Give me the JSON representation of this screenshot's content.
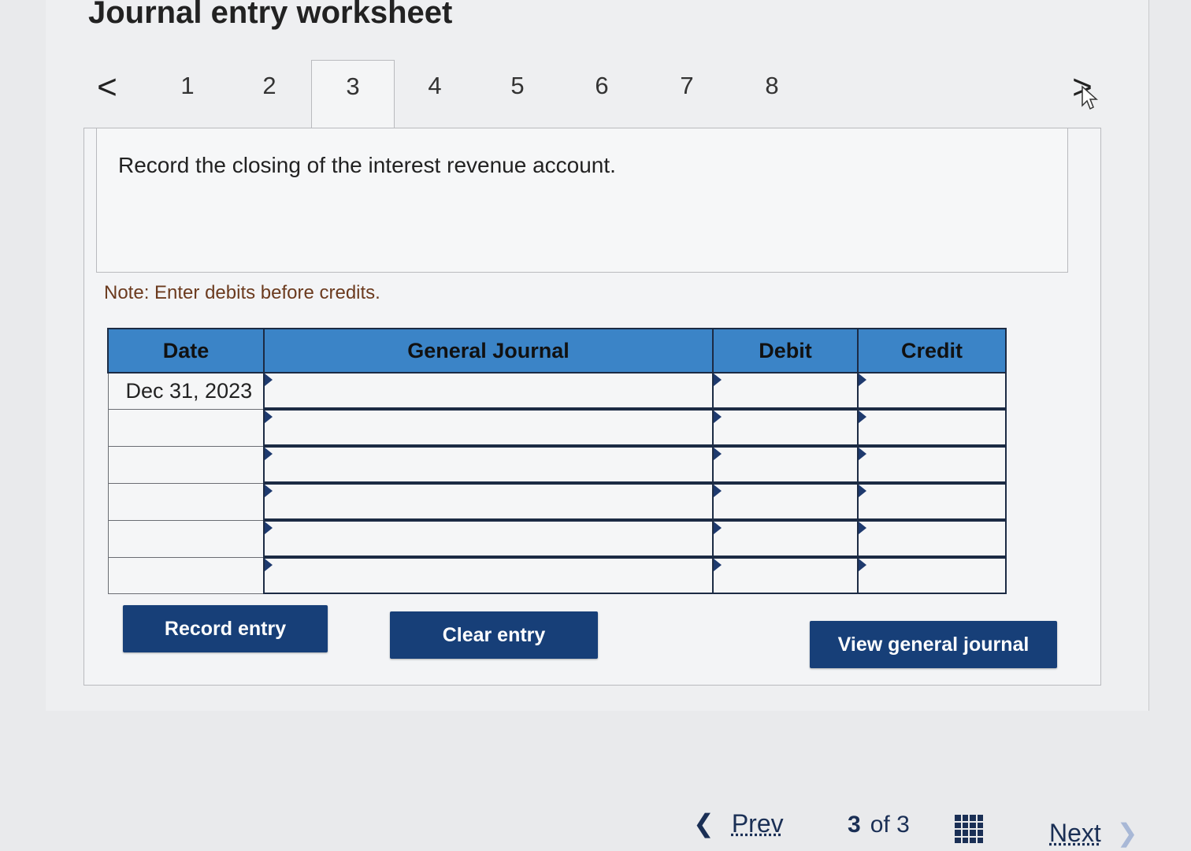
{
  "title": "Journal entry worksheet",
  "tabs": {
    "prev_glyph": "<",
    "next_glyph": ">",
    "items": [
      "1",
      "2",
      "3",
      "4",
      "5",
      "6",
      "7",
      "8"
    ],
    "active": "3"
  },
  "instruction": "Record the closing of the interest revenue account.",
  "note": "Note: Enter debits before credits.",
  "table": {
    "headers": [
      "Date",
      "General Journal",
      "Debit",
      "Credit"
    ],
    "rows": [
      {
        "date": "Dec 31, 2023",
        "account": "",
        "debit": "",
        "credit": ""
      },
      {
        "date": "",
        "account": "",
        "debit": "",
        "credit": ""
      },
      {
        "date": "",
        "account": "",
        "debit": "",
        "credit": ""
      },
      {
        "date": "",
        "account": "",
        "debit": "",
        "credit": ""
      },
      {
        "date": "",
        "account": "",
        "debit": "",
        "credit": ""
      },
      {
        "date": "",
        "account": "",
        "debit": "",
        "credit": ""
      }
    ]
  },
  "buttons": {
    "record": "Record entry",
    "clear": "Clear entry",
    "view": "View general journal"
  },
  "bottom_nav": {
    "prev_label": "Prev",
    "current": "3",
    "of_label": "of",
    "total": "3",
    "next_label": "Next",
    "grid_icon": "grid-icon"
  },
  "colors": {
    "header_blue": "#3b84c7",
    "button_navy": "#173f78",
    "note_brown": "#6b3a1e"
  }
}
